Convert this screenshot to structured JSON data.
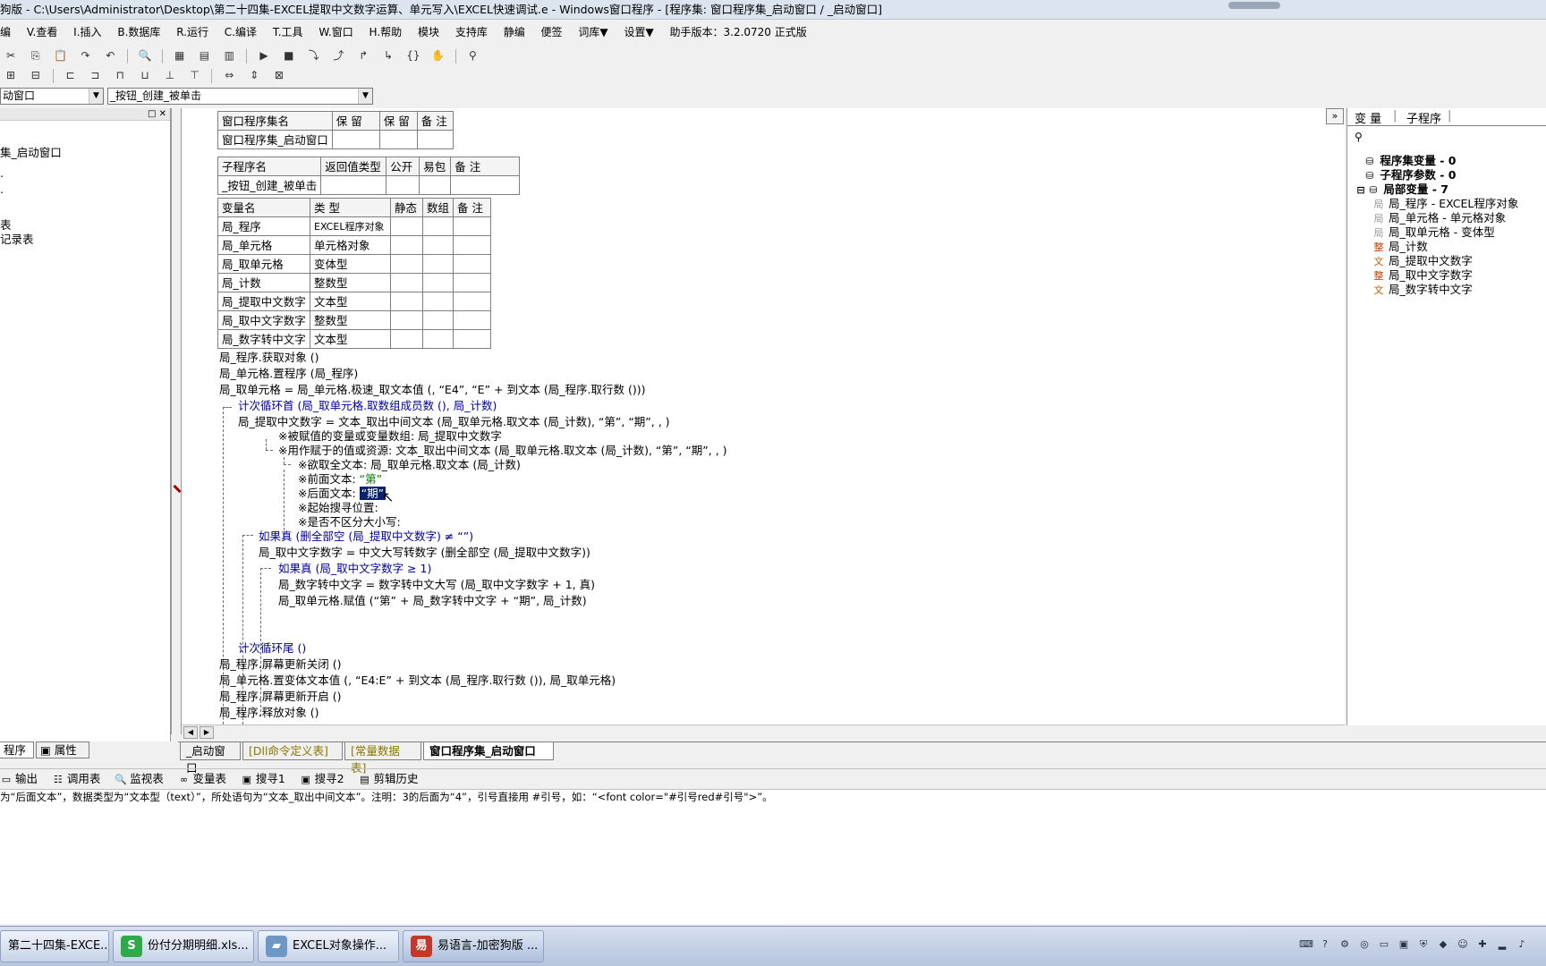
{
  "window": {
    "title": "狗版 - C:\\Users\\Administrator\\Desktop\\第二十四集-EXCEL提取中文数字运算、单元写入\\EXCEL快速调试.e - Windows窗口程序 - [程序集: 窗口程序集_启动窗口 / _启动窗口]"
  },
  "menu": [
    "编",
    "V.查看",
    "I.插入",
    "B.数据库",
    "R.运行",
    "C.编译",
    "T.工具",
    "W.窗口",
    "H.帮助",
    "模块",
    "支持库",
    "静编",
    "便签",
    "词库▼",
    "设置▼",
    "助手版本：3.2.0720 正式版"
  ],
  "combos": {
    "left": "动窗口",
    "right": "_按钮_创建_被单击"
  },
  "left_panel": {
    "items": [
      "集_启动窗口",
      ".",
      ".",
      "表",
      "记录表"
    ],
    "tabs": [
      "程序",
      "属性"
    ]
  },
  "assembly_table": {
    "headers": [
      "窗口程序集名",
      "保 留",
      "保 留",
      "备 注"
    ],
    "rows": [
      [
        "窗口程序集_启动窗口",
        "",
        "",
        ""
      ]
    ]
  },
  "sub_table": {
    "headers": [
      "子程序名",
      "返回值类型",
      "公开",
      "易包",
      "备 注"
    ],
    "rows": [
      [
        "_按钮_创建_被单击",
        "",
        "",
        "",
        ""
      ]
    ]
  },
  "var_table": {
    "headers": [
      "变量名",
      "类 型",
      "静态",
      "数组",
      "备 注"
    ],
    "rows": [
      [
        "局_程序",
        "EXCEL程序对象",
        "",
        "",
        ""
      ],
      [
        "局_单元格",
        "单元格对象",
        "",
        "",
        ""
      ],
      [
        "局_取单元格",
        "变体型",
        "",
        "",
        ""
      ],
      [
        "局_计数",
        "整数型",
        "",
        "",
        ""
      ],
      [
        "局_提取中文数字",
        "文本型",
        "",
        "",
        ""
      ],
      [
        "局_取中文字数字",
        "整数型",
        "",
        "",
        ""
      ],
      [
        "局_数字转中文字",
        "文本型",
        "",
        "",
        ""
      ]
    ]
  },
  "code": {
    "l1": "局_程序.获取对象 ()",
    "l2": "局_单元格.置程序 (局_程序)",
    "l3": "局_取单元格 = 局_单元格.极速_取文本值 (, “E4”, “E” + 到文本 (局_程序.取行数 ()))",
    "l4": "计次循环首 (局_取单元格.取数组成员数 (), 局_计数)",
    "l5": "局_提取中文数字 = 文本_取出中间文本 (局_取单元格.取文本 (局_计数), “第”, “期”, , )",
    "l6": "※被赋值的变量或变量数组: 局_提取中文数字",
    "l7": "※用作赋于的值或资源: 文本_取出中间文本 (局_取单元格.取文本 (局_计数), “第”, “期”, , )",
    "l8": "※欲取全文本: 局_取单元格.取文本 (局_计数)",
    "l9a": "※前面文本: ",
    "l9b": "“第”",
    "l10a": "※后面文本: ",
    "l10b": "“期”",
    "l11": "※起始搜寻位置:",
    "l12": "※是否不区分大小写:",
    "l13": "如果真 (删全部空 (局_提取中文数字) ≠ “”)",
    "l14": "局_取中文字数字 = 中文大写转数字 (删全部空 (局_提取中文数字))",
    "l15": "如果真 (局_取中文字数字 ≥ 1)",
    "l16": "局_数字转中文字 = 数字转中文大写 (局_取中文字数字 + 1, 真)",
    "l17": "局_取单元格.赋值 (“第” + 局_数字转中文字 + “期”, 局_计数)",
    "l18": "计次循环尾 ()",
    "l19": "局_程序.屏幕更新关闭 ()",
    "l20": "局_单元格.置变体文本值 (, “E4:E” + 到文本 (局_程序.取行数 ()), 局_取单元格)",
    "l21": "局_程序.屏幕更新开启 ()",
    "l22": "局_程序.释放对象 ()"
  },
  "doc_tabs": [
    "_启动窗口",
    "[Dll命令定义表]",
    "[常量数据表]",
    "窗口程序集_启动窗口"
  ],
  "right_panel": {
    "tabs": [
      "变 量",
      "子程序"
    ],
    "tree": [
      {
        "label": "程序集变量 - 0",
        "bold": true
      },
      {
        "label": "子程序参数 - 0",
        "bold": true
      },
      {
        "label": "局部变量 - 7",
        "bold": true
      },
      {
        "label": "局_程序 - EXCEL程序对象",
        "bold": false
      },
      {
        "label": "局_单元格 - 单元格对象",
        "bold": false
      },
      {
        "label": "局_取单元格 - 变体型",
        "bold": false
      },
      {
        "label": "局_计数",
        "bold": false
      },
      {
        "label": "局_提取中文数字",
        "bold": false
      },
      {
        "label": "局_取中文字数字",
        "bold": false
      },
      {
        "label": "局_数字转中文字",
        "bold": false
      }
    ]
  },
  "output_tabs": [
    "输出",
    "调用表",
    "监视表",
    "变量表",
    "搜寻1",
    "搜寻2",
    "剪辑历史"
  ],
  "output_text": "为“后面文本”，数据类型为“文本型（text）”，所处语句为“文本_取出中间文本”。注明：3的后面为“4”，引号直接用 #引号，如：“<font color=\"#引号red#引号\">”。",
  "taskbar": [
    "第二十四集-EXCE...",
    "份付分期明细.xls...",
    "EXCEL对象操作...",
    "易语言-加密狗版 ..."
  ]
}
